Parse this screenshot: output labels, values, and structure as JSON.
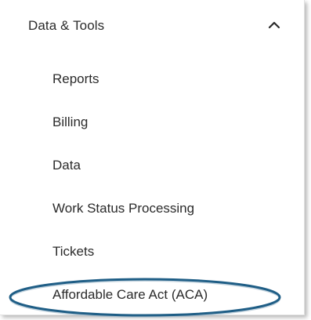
{
  "section": {
    "title": "Data & Tools",
    "expanded_icon": "chevron-up-icon"
  },
  "menu_items": [
    {
      "label": "Reports"
    },
    {
      "label": "Billing"
    },
    {
      "label": "Data"
    },
    {
      "label": "Work Status Processing"
    },
    {
      "label": "Tickets"
    },
    {
      "label": "Affordable Care Act (ACA)"
    }
  ],
  "annotation": {
    "highlight_color": "#1f5e86",
    "highlighted_item": "Affordable Care Act (ACA)"
  }
}
